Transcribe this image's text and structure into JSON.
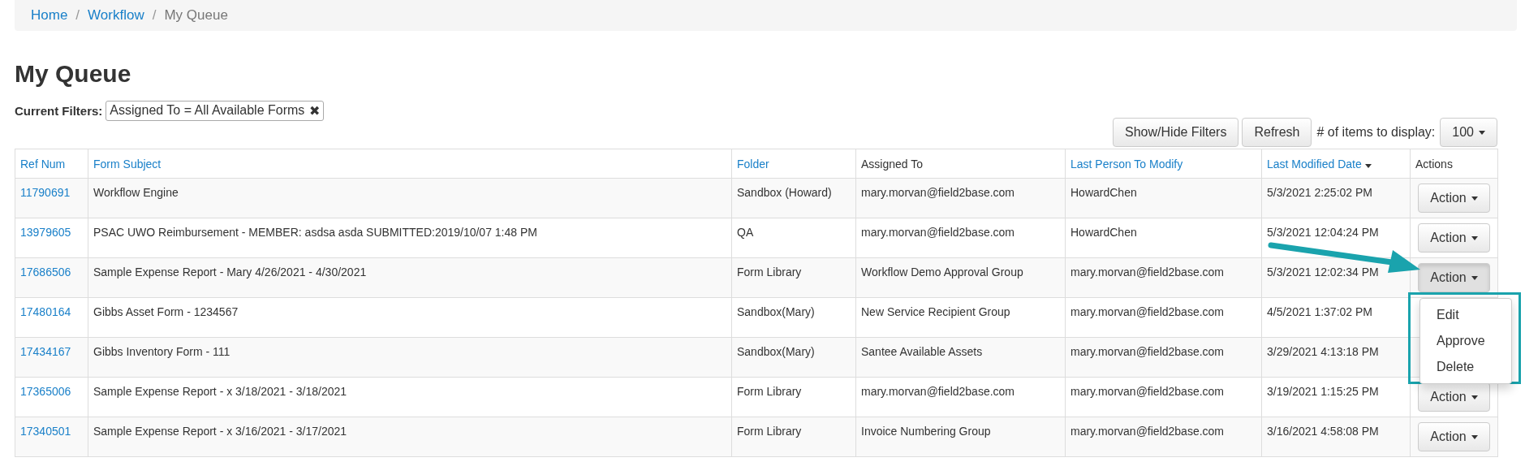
{
  "breadcrumb": [
    {
      "label": "Home",
      "kind": "link"
    },
    {
      "label": "Workflow",
      "kind": "link"
    },
    {
      "label": "My Queue",
      "kind": "current"
    }
  ],
  "breadcrumb_separator": "/",
  "title": "My Queue",
  "filters": {
    "label": "Current Filters:",
    "tags": [
      {
        "text": "Assigned To = All Available Forms",
        "remove": "✖"
      }
    ]
  },
  "toolbar": {
    "buttons": [
      "Show/Hide Filters",
      "Refresh"
    ],
    "display_label": "# of items to display:",
    "display_value": "100"
  },
  "table": {
    "columns": [
      {
        "label": "Ref Num",
        "sortable": true,
        "sorted": false
      },
      {
        "label": "Form Subject",
        "sortable": true,
        "sorted": false
      },
      {
        "label": "Folder",
        "sortable": true,
        "sorted": false
      },
      {
        "label": "Assigned To",
        "sortable": false,
        "sorted": false
      },
      {
        "label": "Last Person To Modify",
        "sortable": true,
        "sorted": false
      },
      {
        "label": "Last Modified Date",
        "sortable": true,
        "sorted": true
      },
      {
        "label": "Actions",
        "sortable": false,
        "sorted": false
      }
    ],
    "rows": [
      {
        "ref": "11790691",
        "subject": "Workflow Engine",
        "folder": "Sandbox (Howard)",
        "assigned_to": "mary.morvan@field2base.com",
        "last_person": "HowardChen",
        "modified": "5/3/2021 2:25:02 PM",
        "action": "Action",
        "open": false
      },
      {
        "ref": "13979605",
        "subject": "PSAC UWO Reimbursement - MEMBER: asdsa asda SUBMITTED:2019/10/07 1:48 PM",
        "folder": "QA",
        "assigned_to": "mary.morvan@field2base.com",
        "last_person": "HowardChen",
        "modified": "5/3/2021 12:04:24 PM",
        "action": "Action",
        "open": false
      },
      {
        "ref": "17686506",
        "subject": "Sample Expense Report - Mary 4/26/2021 - 4/30/2021",
        "folder": "Form Library",
        "assigned_to": "Workflow Demo Approval Group",
        "last_person": "mary.morvan@field2base.com",
        "modified": "5/3/2021 12:02:34 PM",
        "action": "Action",
        "open": true
      },
      {
        "ref": "17480164",
        "subject": "Gibbs Asset Form - 1234567",
        "folder": "Sandbox(Mary)",
        "assigned_to": "New Service Recipient Group",
        "last_person": "mary.morvan@field2base.com",
        "modified": "4/5/2021 1:37:02 PM"
      },
      {
        "ref": "17434167",
        "subject": "Gibbs Inventory Form - 111",
        "folder": "Sandbox(Mary)",
        "assigned_to": "Santee Available Assets",
        "last_person": "mary.morvan@field2base.com",
        "modified": "3/29/2021 4:13:18 PM"
      },
      {
        "ref": "17365006",
        "subject": "Sample Expense Report - x 3/18/2021 - 3/18/2021",
        "folder": "Form Library",
        "assigned_to": "mary.morvan@field2base.com",
        "last_person": "mary.morvan@field2base.com",
        "modified": "3/19/2021 1:15:25 PM",
        "action": "Action",
        "open": false
      },
      {
        "ref": "17340501",
        "subject": "Sample Expense Report - x 3/16/2021 - 3/17/2021",
        "folder": "Form Library",
        "assigned_to": "Invoice Numbering Group",
        "last_person": "mary.morvan@field2base.com",
        "modified": "3/16/2021 4:58:08 PM",
        "action": "Action",
        "open": false
      }
    ],
    "action_menu": [
      "Edit",
      "Approve",
      "Delete"
    ]
  }
}
